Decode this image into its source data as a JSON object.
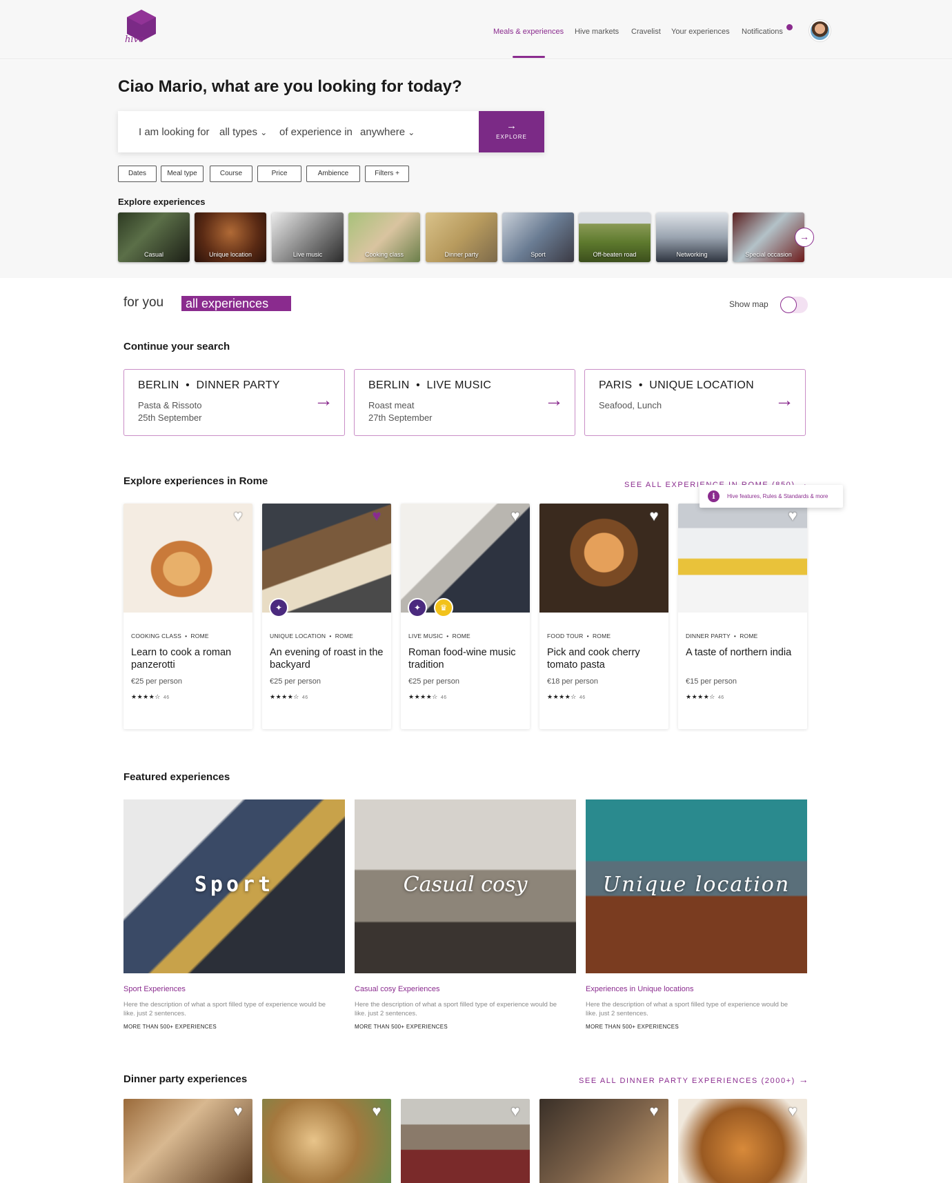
{
  "header": {
    "logo_text": "hive",
    "nav": [
      "Meals & experiences",
      "Hive markets",
      "Cravelist",
      "Your experiences",
      "Notifications"
    ]
  },
  "hero": {
    "greeting": "Ciao Mario, what are you looking for today?",
    "search": {
      "prefix": "I am looking for",
      "type_value": "all types",
      "middle": "of experience in",
      "location_value": "anywhere"
    },
    "explore_button": "EXPLORE",
    "filters": [
      "Dates",
      "Meal type",
      "Course",
      "Price",
      "Ambience",
      "Filters +"
    ],
    "explore_heading": "Explore experiences",
    "categories": [
      "Casual",
      "Unique location",
      "Live music",
      "Cooking class",
      "Dinner party",
      "Sport",
      "Off-beaten road",
      "Networking",
      "Special occasion"
    ]
  },
  "tabs": {
    "for_you": "for you",
    "all_experiences": "all experiences",
    "show_map": "Show map"
  },
  "continue": {
    "heading": "Continue your search",
    "cards": [
      {
        "city": "BERLIN",
        "type": "DINNER PARTY",
        "line1": "Pasta & Rissoto",
        "line2": "25th September"
      },
      {
        "city": "BERLIN",
        "type": "LIVE MUSIC",
        "line1": "Roast meat",
        "line2": "27th September"
      },
      {
        "city": "PARIS",
        "type": "UNIQUE LOCATION",
        "line1": "Seafood, Lunch",
        "line2": ""
      }
    ]
  },
  "rome": {
    "heading": "Explore experiences in Rome",
    "see_all": "SEE ALL EXPERIENCE IN ROME (850)",
    "tooltip": "Hive features, Rules & Standards & more",
    "cards": [
      {
        "category": "COOKING CLASS",
        "city": "ROME",
        "title": "Learn to cook a roman panzerotti",
        "price": "€25 per person",
        "stars": "★★★★☆",
        "reviews": "46"
      },
      {
        "category": "UNIQUE LOCATION",
        "city": "ROME",
        "title": "An evening of roast in the backyard",
        "price": "€25 per person",
        "stars": "★★★★☆",
        "reviews": "46"
      },
      {
        "category": "LIVE MUSIC",
        "city": "ROME",
        "title": "Roman food-wine music tradition",
        "price": "€25 per person",
        "stars": "★★★★☆",
        "reviews": "46"
      },
      {
        "category": "FOOD TOUR",
        "city": "ROME",
        "title": "Pick and cook cherry tomato pasta",
        "price": "€18 per person",
        "stars": "★★★★☆",
        "reviews": "46"
      },
      {
        "category": "DINNER PARTY",
        "city": "ROME",
        "title": "A taste of northern india",
        "price": "€15 per person",
        "stars": "★★★★☆",
        "reviews": "46"
      }
    ]
  },
  "featured": {
    "heading": "Featured experiences",
    "cards": [
      {
        "overlay": "Sport",
        "title": "Sport Experiences",
        "desc": "Here the description of what a sport filled type of experience would be like. just 2 sentences.",
        "more": "MORE THAN 500+ EXPERIENCES"
      },
      {
        "overlay": "Casual cosy",
        "title": "Casual cosy Experiences",
        "desc": "Here the description of what a sport filled type of experience would be like. just 2 sentences.",
        "more": "MORE THAN 500+ EXPERIENCES"
      },
      {
        "overlay": "Unique location",
        "title": "Experiences in Unique locations",
        "desc": "Here the description of what a sport filled type of experience would be like. just 2 sentences.",
        "more": "MORE THAN 500+ EXPERIENCES"
      }
    ]
  },
  "dinner": {
    "heading": "Dinner party experiences",
    "see_all": "SEE ALL DINNER PARTY EXPERIENCES (2000+)"
  },
  "icons": {
    "arrow": "→",
    "chevron": "⌄",
    "heart": "♥",
    "info": "i",
    "magic": "magic-wand-icon",
    "chef": "chef-hat-icon"
  },
  "colors": {
    "accent": "#8a2b8e",
    "explore_button": "#7b2a86",
    "card_border": "#c98dc6"
  }
}
